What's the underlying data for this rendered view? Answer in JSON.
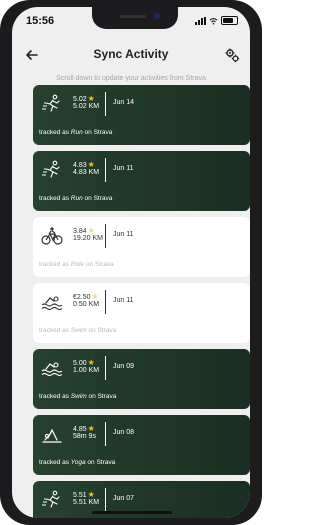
{
  "status": {
    "time": "15:56"
  },
  "header": {
    "title": "Sync Activity"
  },
  "hint": "Scroll down to update your activities from Strava",
  "activities": [
    {
      "theme": "dark",
      "icon": "run-icon",
      "points": "5.02",
      "distance": "5.02 KM",
      "date": "Jun 14",
      "tracked_prefix": "tracked as ",
      "type": "Run",
      "tracked_suffix": " on Strava"
    },
    {
      "theme": "dark",
      "icon": "run-icon",
      "points": "4.83",
      "distance": "4.83 KM",
      "date": "Jun 11",
      "tracked_prefix": "tracked as ",
      "type": "Run",
      "tracked_suffix": " on Strava"
    },
    {
      "theme": "light",
      "icon": "bike-icon",
      "points": "3.84",
      "distance": "19.20 KM",
      "date": "Jun 11",
      "tracked_prefix": "tracked as ",
      "type": "Ride",
      "tracked_suffix": " on Strava"
    },
    {
      "theme": "light",
      "icon": "swim-icon",
      "points": "€2.50",
      "distance": "0.50 KM",
      "date": "Jun 11",
      "tracked_prefix": "tracked as ",
      "type": "Swim",
      "tracked_suffix": " on Strava"
    },
    {
      "theme": "dark",
      "icon": "swim-icon",
      "points": "5.00",
      "distance": "1.00 KM",
      "date": "Jun 09",
      "tracked_prefix": "tracked as ",
      "type": "Swim",
      "tracked_suffix": " on Strava"
    },
    {
      "theme": "dark",
      "icon": "yoga-icon",
      "points": "4.85",
      "distance": "58m 9s",
      "date": "Jun 08",
      "tracked_prefix": "tracked as ",
      "type": "Yoga",
      "tracked_suffix": " on Strava"
    },
    {
      "theme": "dark",
      "icon": "run-icon",
      "points": "5.51",
      "distance": "5.51 KM",
      "date": "Jun 07",
      "tracked_prefix": "tracked as ",
      "type": "Run",
      "tracked_suffix": " on Strava"
    }
  ],
  "colors": {
    "card_dark": "#1e3526",
    "star": "#f5c32e",
    "background": "#efefef"
  }
}
